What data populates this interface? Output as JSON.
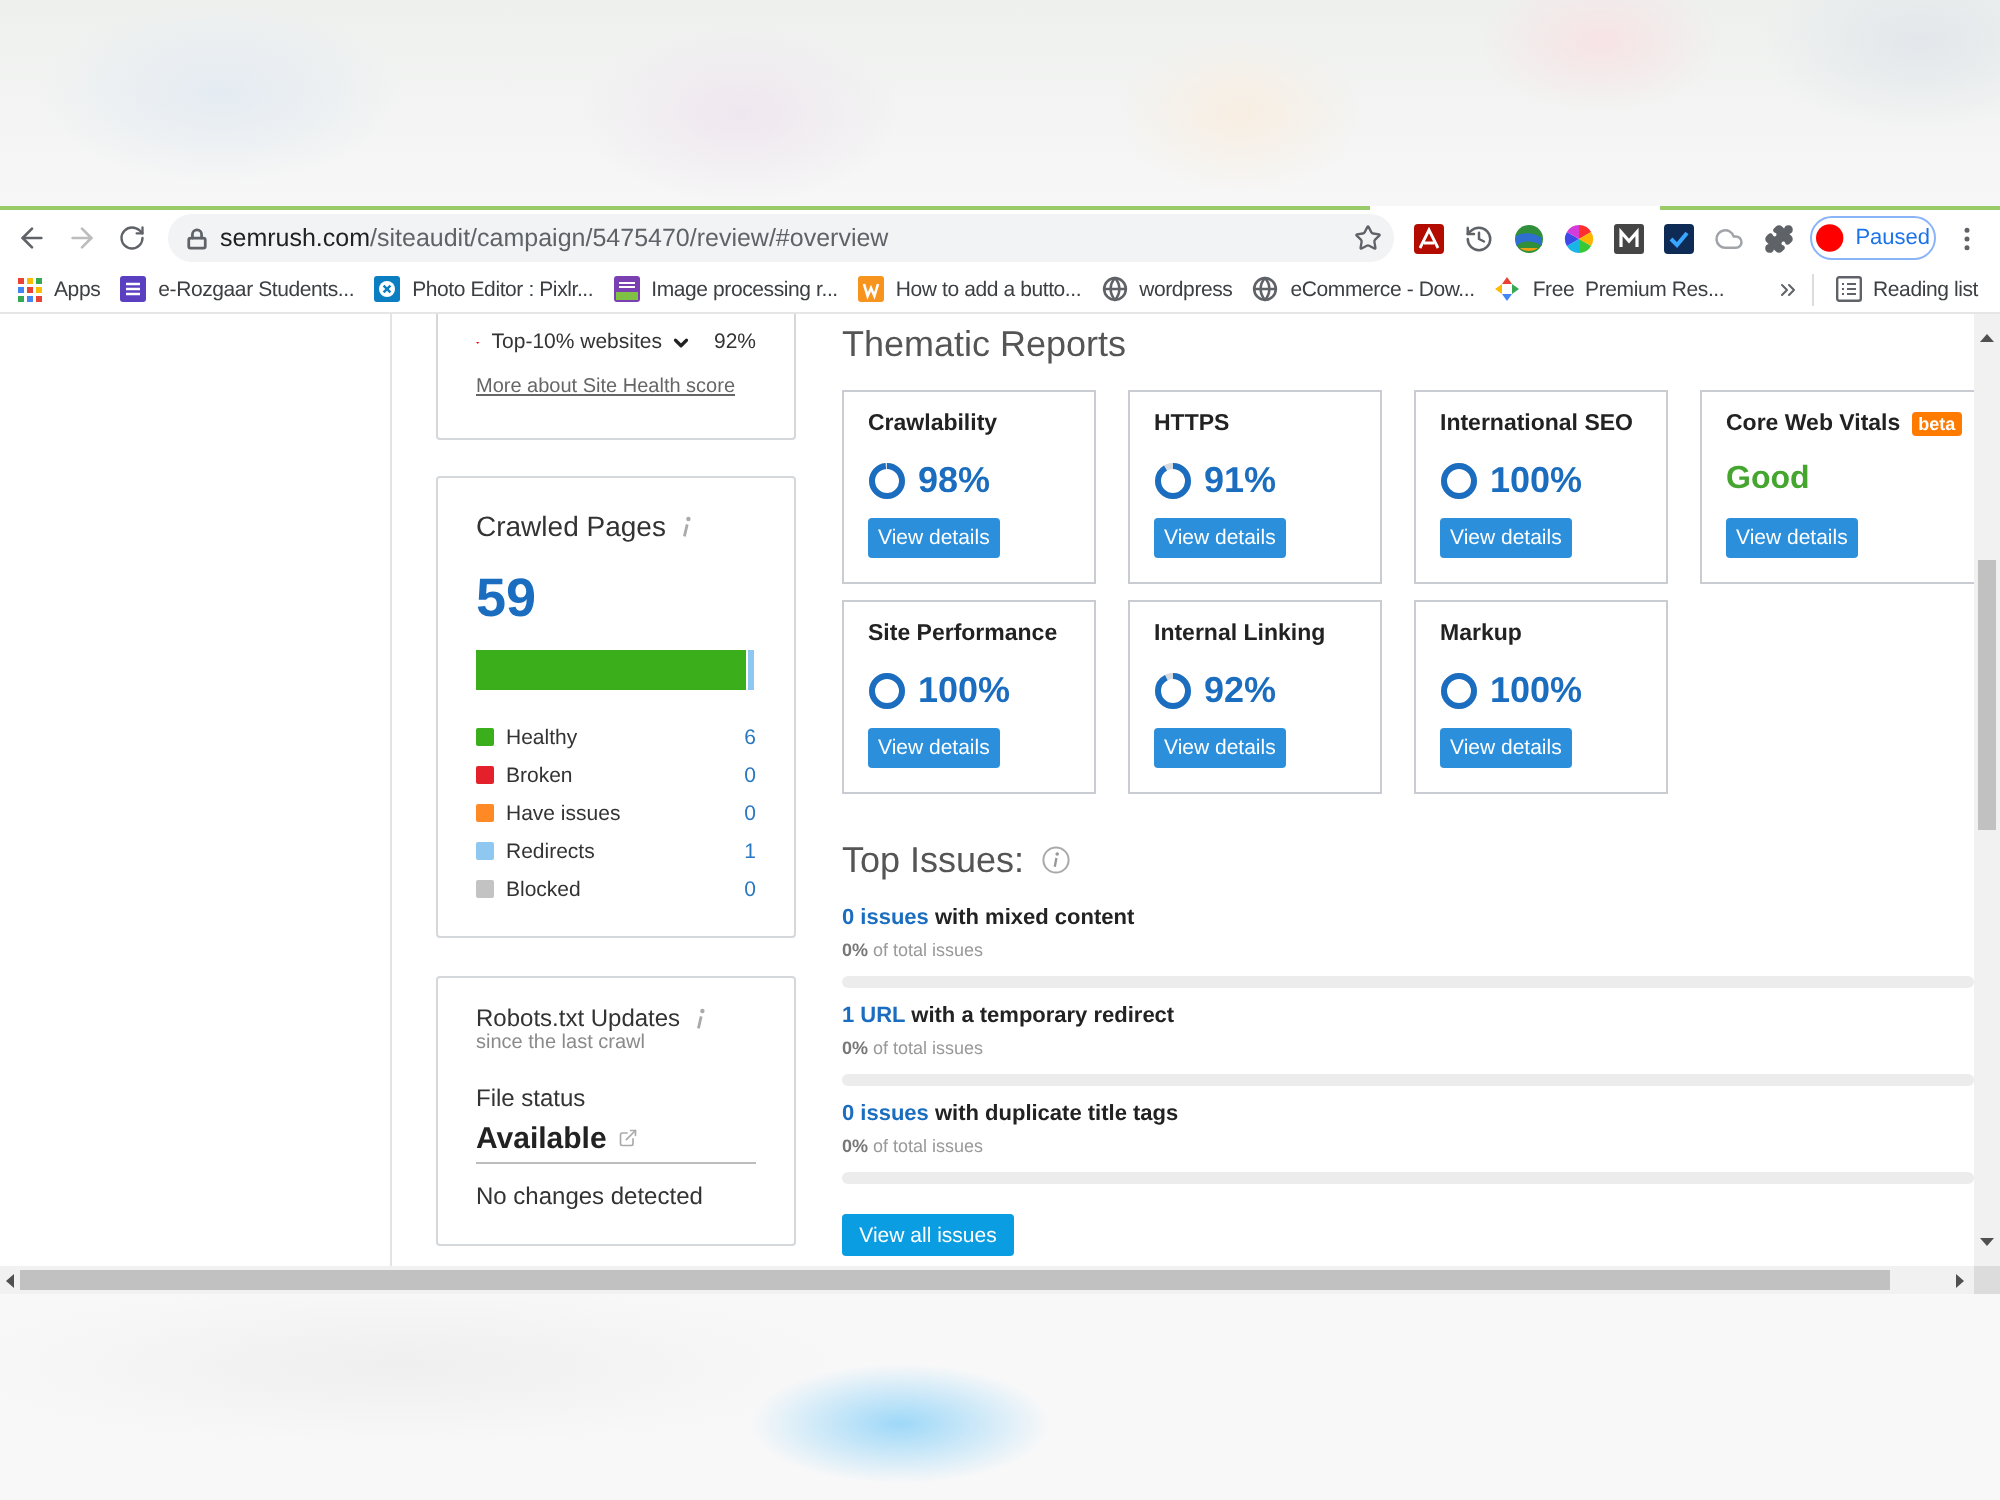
{
  "browser": {
    "back": {
      "disabled": false
    },
    "forward": {
      "disabled": true
    },
    "url": {
      "host": "semrush.com",
      "path": "/siteaudit/campaign/5475470/review/#overview"
    },
    "profile": {
      "label": "Paused"
    },
    "bookmarks": [
      {
        "label": "Apps"
      },
      {
        "label": "e-Rozgaar Students..."
      },
      {
        "label": "Photo Editor : Pixlr..."
      },
      {
        "label": "Image processing r..."
      },
      {
        "label": "How to add a butto..."
      },
      {
        "label": "wordpress"
      },
      {
        "label": "eCommerce - Dow..."
      },
      {
        "label": "Free  Premium Res..."
      }
    ],
    "reading_list": {
      "label": "Reading list"
    }
  },
  "site_health": {
    "benchmark": "Top-10% websites",
    "benchmark_value": "92%",
    "link": "More about Site Health score"
  },
  "crawled_pages": {
    "title": "Crawled Pages",
    "total": "59",
    "breakdown": [
      {
        "label": "Healthy",
        "value": "6",
        "color": "#3aae1b",
        "level": 0.971
      },
      {
        "label": "Broken",
        "value": "0",
        "color": "#e4202b"
      },
      {
        "label": "Have issues",
        "value": "0",
        "color": "#ff8a25"
      },
      {
        "label": "Redirects",
        "value": "1",
        "color": "#8ec8f0",
        "level": 0.029
      },
      {
        "label": "Blocked",
        "value": "0",
        "color": "#c3c3c3"
      }
    ]
  },
  "robots": {
    "title": "Robots.txt Updates",
    "subtitle": "since the last crawl",
    "file_status_label": "File status",
    "file_status": "Available",
    "changes": "No changes detected"
  },
  "thematic_reports": {
    "title": "Thematic Reports",
    "reports": [
      {
        "kind": "score",
        "title": "Crawlability",
        "value": "98%",
        "level": 0.98,
        "button": "View details"
      },
      {
        "kind": "score",
        "title": "HTTPS",
        "value": "91%",
        "level": 0.91,
        "button": "View details"
      },
      {
        "kind": "score",
        "title": "International SEO",
        "value": "100%",
        "level": 1,
        "button": "View details"
      },
      {
        "kind": "status",
        "title": "Core Web Vitals",
        "badge": "beta",
        "value": "Good",
        "button": "View details"
      },
      {
        "kind": "score",
        "title": "Site Performance",
        "value": "100%",
        "level": 1,
        "button": "View details"
      },
      {
        "kind": "score",
        "title": "Internal Linking",
        "value": "92%",
        "level": 0.92,
        "button": "View details"
      },
      {
        "kind": "score",
        "title": "Markup",
        "value": "100%",
        "level": 1,
        "button": "View details"
      }
    ]
  },
  "top_issues": {
    "title": "Top Issues:",
    "issues": [
      {
        "count": "0 issues",
        "text": "with mixed content",
        "share": "**0%** of total issues"
      },
      {
        "count": "1 URL",
        "text": "with a temporary redirect",
        "share": "**0%** of total issues"
      },
      {
        "count": "0 issues",
        "text": "with duplicate title tags",
        "share": "**0%** of total issues"
      }
    ],
    "button": "View all issues"
  }
}
